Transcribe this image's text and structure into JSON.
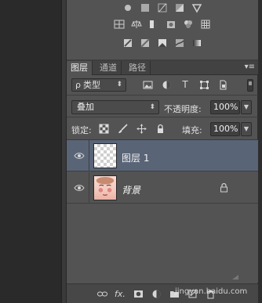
{
  "tabs": [
    {
      "label": "图层",
      "active": true
    },
    {
      "label": "通道",
      "active": false
    },
    {
      "label": "路径",
      "active": false
    }
  ],
  "panel_menu": {
    "icon": "panel-menu-icon"
  },
  "filter": {
    "label": "类型",
    "icon": "search-icon"
  },
  "blend": {
    "mode": "叠加",
    "opacity_label": "不透明度:",
    "opacity_value": "100%"
  },
  "lock": {
    "label": "锁定:",
    "fill_label": "填充:",
    "fill_value": "100%"
  },
  "layers": [
    {
      "name": "图层 1",
      "selected": true,
      "visible": true
    },
    {
      "name": "背景",
      "selected": false,
      "visible": true,
      "locked": true
    }
  ],
  "bottom_icons": [
    "link-icon",
    "fx-icon",
    "mask-icon",
    "adjustment-icon",
    "group-folder-icon",
    "new-layer-icon",
    "trash-icon"
  ],
  "bottom_fx_label": "fx.",
  "watermark": "jingyan.baidu.com",
  "colors": {
    "panel": "#535353",
    "selected_row": "#596477",
    "tab_bar": "#424242"
  }
}
